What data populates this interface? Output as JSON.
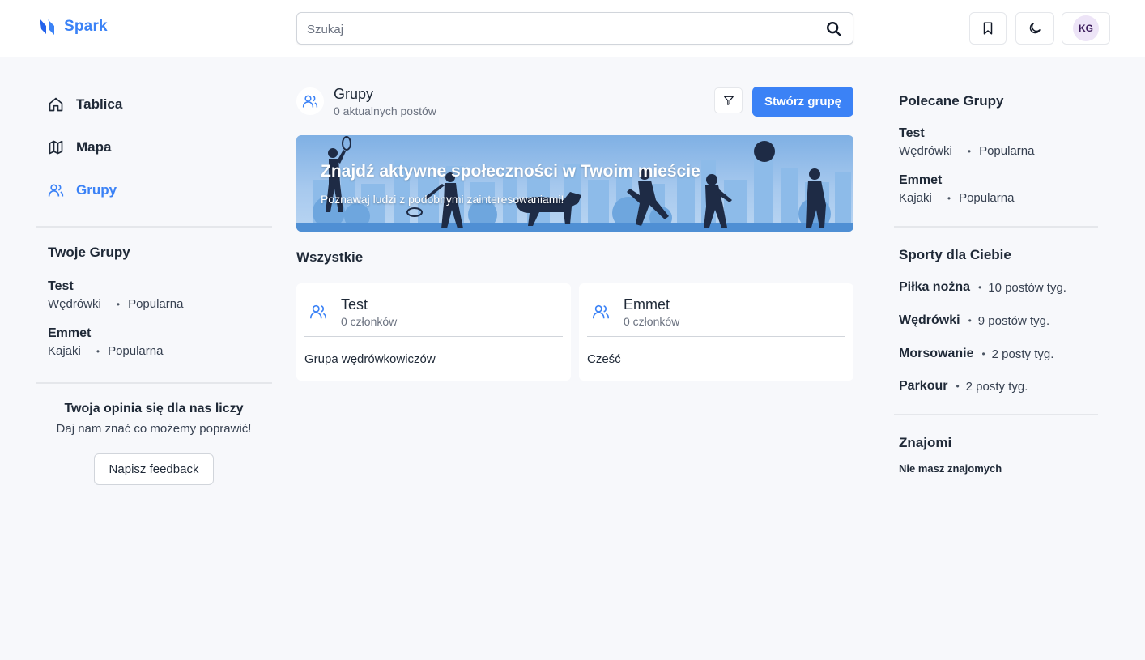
{
  "header": {
    "logo_text": "Spark",
    "search_placeholder": "Szukaj",
    "avatar_initials": "KG"
  },
  "nav": {
    "items": [
      {
        "label": "Tablica",
        "icon": "home-icon"
      },
      {
        "label": "Mapa",
        "icon": "map-icon"
      },
      {
        "label": "Grupy",
        "icon": "users-icon",
        "active": true
      }
    ]
  },
  "your_groups": {
    "title": "Twoje Grupy",
    "groups": [
      {
        "name": "Test",
        "category": "Wędrówki",
        "tag": "Popularna"
      },
      {
        "name": "Emmet",
        "category": "Kajaki",
        "tag": "Popularna"
      }
    ]
  },
  "feedback": {
    "title": "Twoja opinia się dla nas liczy",
    "subtitle": "Daj nam znać co możemy poprawić!",
    "button_label": "Napisz feedback"
  },
  "main": {
    "title": "Grupy",
    "subtitle": "0 aktualnych postów",
    "create_button_label": "Stwórz grupę",
    "banner": {
      "title": "Znajdź aktywne społeczności w Twoim mieście",
      "subtitle": "Poznawaj ludzi z podobnymi zainteresowaniami!"
    },
    "all_title": "Wszystkie",
    "cards": [
      {
        "name": "Test",
        "members": "0 członków",
        "description": "Grupa wędrówkowiczów"
      },
      {
        "name": "Emmet",
        "members": "0 członków",
        "description": "Cześć"
      }
    ]
  },
  "recommended": {
    "title": "Polecane Grupy",
    "groups": [
      {
        "name": "Test",
        "category": "Wędrówki",
        "tag": "Popularna"
      },
      {
        "name": "Emmet",
        "category": "Kajaki",
        "tag": "Popularna"
      }
    ]
  },
  "sports": {
    "title": "Sporty dla Ciebie",
    "items": [
      {
        "name": "Piłka nożna",
        "count": "10 postów tyg."
      },
      {
        "name": "Wędrówki",
        "count": "9 postów tyg."
      },
      {
        "name": "Morsowanie",
        "count": "2 posty tyg."
      },
      {
        "name": "Parkour",
        "count": "2 posty tyg."
      }
    ]
  },
  "friends": {
    "title": "Znajomi",
    "empty_text": "Nie masz znajomych"
  },
  "colors": {
    "accent": "#3b82f6",
    "background": "#f7f8fb"
  }
}
